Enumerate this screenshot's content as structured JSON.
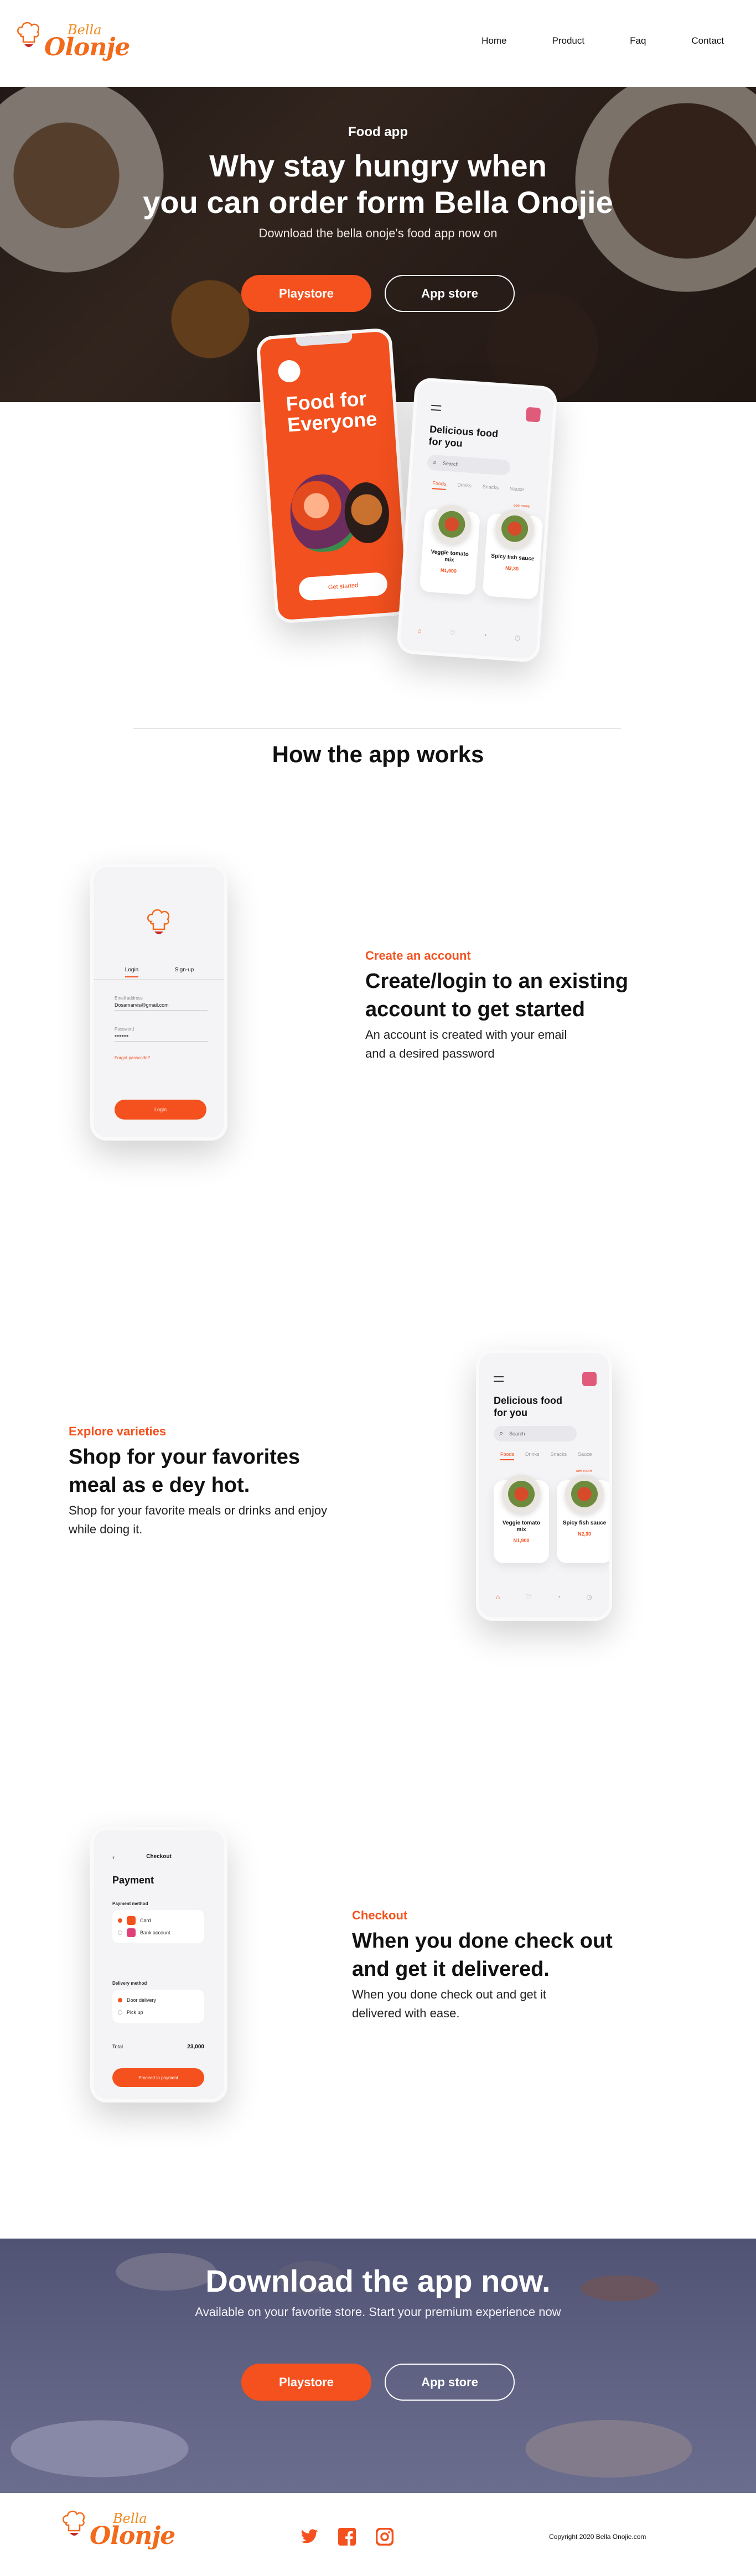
{
  "brand": {
    "logo_small": "Bella",
    "logo_large": "Olonje",
    "accent": "#f4511e"
  },
  "nav": {
    "links": [
      "Home",
      "Product",
      "Faq",
      "Contact"
    ]
  },
  "hero": {
    "kicker": "Food app",
    "title_line1": "Why stay hungry when",
    "title_line2": "you can order form Bella Onojie",
    "subtitle": "Download the bella onoje's food app now on",
    "btn_playstore": "Playstore",
    "btn_appstore": "App store"
  },
  "hero_phone": {
    "title_line1": "Food for",
    "title_line2": "Everyone",
    "get_started": "Get started"
  },
  "food_screen": {
    "title": "Delicious food for you",
    "search_placeholder": "Search",
    "tabs": [
      "Foods",
      "Drinks",
      "Snacks",
      "Sauce"
    ],
    "see_more": "see more",
    "cards": [
      {
        "name": "Veggie tomato mix",
        "price": "N1,900"
      },
      {
        "name": "Spicy fish sauce",
        "price": "N2,30"
      }
    ]
  },
  "how": {
    "title": "How the app works"
  },
  "features": [
    {
      "kicker": "Create an account",
      "title_line1": "Create/login to an existing",
      "title_line2": "account to get started",
      "desc_line1": "An account is created with your email",
      "desc_line2": "and a desired password"
    },
    {
      "kicker": "Explore varieties",
      "title_line1": "Shop for your favorites",
      "title_line2": "meal as e dey hot.",
      "desc_line1": "Shop for your favorite meals or drinks and enjoy",
      "desc_line2": "while doing it."
    },
    {
      "kicker": "Checkout",
      "title_line1": "When you done check out",
      "title_line2": "and get it delivered.",
      "desc_line1": "When you done check out and get it",
      "desc_line2": "delivered with ease."
    }
  ],
  "login_screen": {
    "tab_login": "Login",
    "tab_signup": "Sign-up",
    "email_label": "Email address",
    "email_value": "Dosamarvis@gmail.com",
    "password_label": "Password",
    "password_value": "••••••••",
    "forgot": "Forgot passcode?",
    "login_btn": "Login"
  },
  "checkout_screen": {
    "back": "‹",
    "header": "Checkout",
    "title": "Payment",
    "payment_method_label": "Payment method",
    "payment_options": [
      "Card",
      "Bank account"
    ],
    "delivery_method_label": "Delivery method",
    "delivery_options": [
      "Door delivery",
      "Pick up"
    ],
    "total_label": "Total",
    "total_value": "23,000",
    "proceed_btn": "Proceed to payment"
  },
  "download": {
    "title": "Download the app now.",
    "subtitle": "Available on your favorite store. Start your premium experience now",
    "btn_playstore": "Playstore",
    "btn_appstore": "App store"
  },
  "footer": {
    "copyright": "Copyright 2020 Bella Onojie.com",
    "socials": [
      "twitter-icon",
      "facebook-icon",
      "instagram-icon"
    ]
  }
}
